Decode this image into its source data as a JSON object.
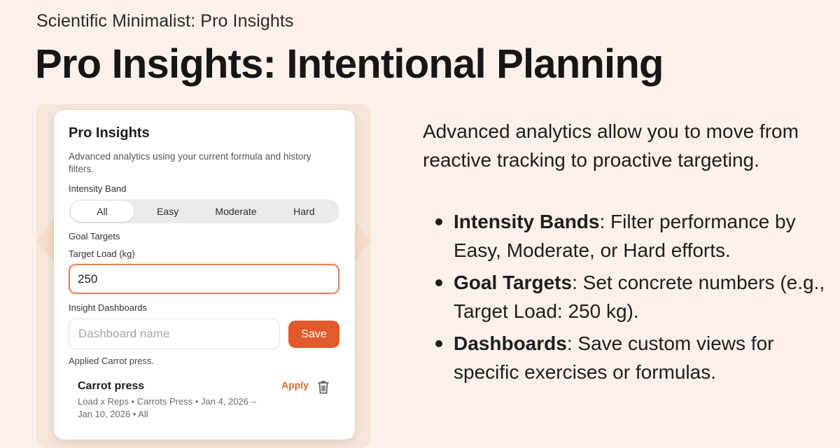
{
  "header": {
    "subtitle": "Scientific Minimalist: Pro Insights",
    "title": "Pro Insights: Intentional Planning"
  },
  "card": {
    "title": "Pro Insights",
    "description": "Advanced analytics using your current formula and history filters.",
    "intensity_label": "Intensity Band",
    "intensity_options": [
      "All",
      "Easy",
      "Moderate",
      "Hard"
    ],
    "intensity_selected": "All",
    "goal_targets_label": "Goal Targets",
    "target_load_label": "Target Load (kg)",
    "target_load_value": "250",
    "dashboards_label": "Insight Dashboards",
    "dashboard_placeholder": "Dashboard name",
    "save_label": "Save",
    "applied_status": "Applied Carrot press.",
    "saved_dashboard": {
      "name": "Carrot press",
      "meta": "Load x Reps • Carrots Press • Jan 4, 2026 – Jan 10, 2026 • All",
      "apply_label": "Apply"
    }
  },
  "explanation": {
    "intro": "Advanced analytics allow you to move from reactive tracking to proactive targeting.",
    "bullets": [
      {
        "term": "Intensity Bands",
        "text": ": Filter performance by Easy, Moderate, or Hard efforts."
      },
      {
        "term": "Goal Targets",
        "text": ": Set concrete numbers (e.g., Target Load: 250 kg)."
      },
      {
        "term": "Dashboards",
        "text": ": Save custom views for specific exercises or formulas."
      }
    ]
  },
  "colors": {
    "accent": "#e2592a",
    "accent_text": "#d8692e",
    "focus_border": "#e0845a",
    "background": "#fcf1ea"
  },
  "icons": {
    "delete": "trash-icon",
    "bullet": "bullet-dot"
  }
}
